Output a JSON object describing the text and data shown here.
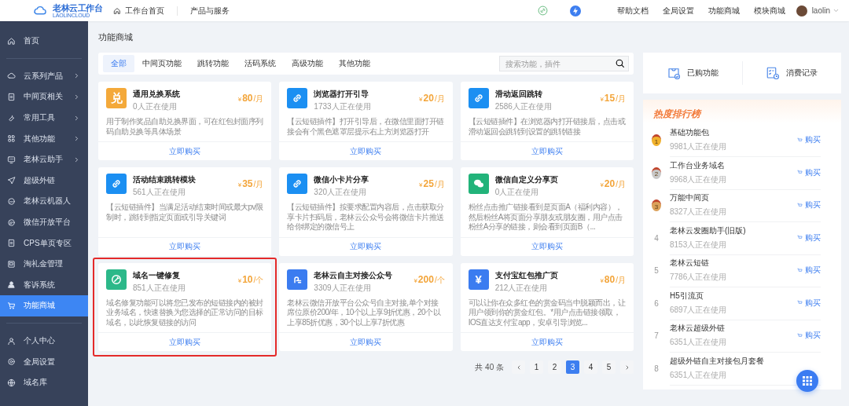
{
  "topbar": {
    "logo": {
      "title": "老林云工作台",
      "subtitle": "LAOLINCLOUD"
    },
    "nav": [
      "工作台首页",
      "产品与服务"
    ],
    "links": [
      "帮助文档",
      "全局设置",
      "功能商城",
      "模块商城"
    ],
    "user": "laolin"
  },
  "sidebar": {
    "sections": [
      {
        "items": [
          {
            "label": "首页",
            "expandable": false,
            "selected": false
          }
        ]
      },
      {
        "items": [
          {
            "label": "云系列产品",
            "expandable": true,
            "selected": false
          },
          {
            "label": "中间页相关",
            "expandable": true,
            "selected": false
          },
          {
            "label": "常用工具",
            "expandable": true,
            "selected": false
          },
          {
            "label": "其他功能",
            "expandable": true,
            "selected": false
          },
          {
            "label": "老林云助手",
            "expandable": true,
            "selected": false
          },
          {
            "label": "超级外链",
            "expandable": false,
            "selected": false
          },
          {
            "label": "老林云机器人",
            "expandable": false,
            "selected": false
          },
          {
            "label": "微信开放平台",
            "expandable": false,
            "selected": false
          },
          {
            "label": "CPS单页专区",
            "expandable": false,
            "selected": false
          },
          {
            "label": "淘礼金管理",
            "expandable": false,
            "selected": false
          },
          {
            "label": "客诉系统",
            "expandable": false,
            "selected": false
          },
          {
            "label": "功能商城",
            "expandable": false,
            "selected": true
          }
        ]
      },
      {
        "items": [
          {
            "label": "个人中心",
            "expandable": false,
            "selected": false
          },
          {
            "label": "全局设置",
            "expandable": false,
            "selected": false
          },
          {
            "label": "域名库",
            "expandable": false,
            "selected": false
          }
        ]
      }
    ]
  },
  "page_title": "功能商城",
  "tabs": [
    {
      "label": "全部",
      "selected": true
    },
    {
      "label": "中间页功能",
      "selected": false
    },
    {
      "label": "跳转功能",
      "selected": false
    },
    {
      "label": "活码系统",
      "selected": false
    },
    {
      "label": "高级功能",
      "selected": false
    },
    {
      "label": "其他功能",
      "selected": false
    }
  ],
  "search": {
    "placeholder": "搜索功能，插件"
  },
  "cards": [
    {
      "name": "通用兑换系统",
      "users": "0人正在使用",
      "currency": "¥",
      "price": "80",
      "unit": " /月",
      "description": "用于制作奖品自助兑换界面，可在红包封面序列码自助兑换等具体场景",
      "action": "立即购买",
      "kind": "glyph",
      "icon_text": "兑",
      "color": "#f4a93a",
      "highlighted": false
    },
    {
      "name": "浏览器打开引导",
      "users": "1733人正在使用",
      "currency": "¥",
      "price": "20",
      "unit": " /月",
      "description": "【云短链插件】打开引导后，在微信里面打开链接会有个黑色遮罩层提示右上方浏览器打开",
      "action": "立即购买",
      "kind": "link",
      "color": "#1b8ff2",
      "highlighted": false
    },
    {
      "name": "滑动返回跳转",
      "users": "2586人正在使用",
      "currency": "¥",
      "price": "15",
      "unit": " /月",
      "description": "【云短链插件】在浏览器内打开链接后，点击或滑动返回会跳转到设置的跳转链接",
      "action": "立即购买",
      "kind": "link",
      "color": "#1b8ff2",
      "highlighted": false
    },
    {
      "name": "活动结束跳转模块",
      "users": "561人正在使用",
      "currency": "¥",
      "price": "35",
      "unit": " /月",
      "description": "【云短链插件】当满足活动结束时间或最大pv限制时，跳转到指定页面或引导关键词",
      "action": "立即购买",
      "kind": "link",
      "color": "#1b8ff2",
      "highlighted": false
    },
    {
      "name": "微信小卡片分享",
      "users": "320人正在使用",
      "currency": "¥",
      "price": "25",
      "unit": " /月",
      "description": "【云短链插件】按要求配置内容后，点击获取分享卡片扫码后，老林云公众号会将微信卡片推送给你绑定的微信号上",
      "action": "立即购买",
      "kind": "link",
      "color": "#1b8ff2",
      "highlighted": false
    },
    {
      "name": "微信自定义分享页",
      "users": "0人正在使用",
      "currency": "¥",
      "price": "20",
      "unit": " /月",
      "description": "粉丝点击推广链接看到是页面A（福利内容），然后粉丝A将页面分享朋友或朋友圈，用户点击粉丝A分享的链接，则会看到页面B（...",
      "action": "立即购买",
      "kind": "chat",
      "color": "#22b37a",
      "highlighted": false
    },
    {
      "name": "域名一键修复",
      "users": "851人正在使用",
      "currency": "¥",
      "price": "10",
      "unit": "/个",
      "description": "域名修复功能可以将您已发布的短链接内的被封业务域名，快速替换为您选择的正常访问的目标域名，以此恢复链接的访问",
      "action": "立即购买",
      "kind": "wrench",
      "color": "#2cb889",
      "highlighted": true
    },
    {
      "name": "老林云自主对接公众号",
      "users": "3309人正在使用",
      "currency": "¥",
      "price": "200",
      "unit": "/个",
      "description": "老林云微信开放平台公众号自主对接,单个对接席位原价200/年，10个以上享9折优惠，20个以上享85折优惠，30个以上享7折优惠",
      "action": "立即购买",
      "kind": "account",
      "color": "#3b7cf0",
      "highlighted": false
    },
    {
      "name": "支付宝红包推广页",
      "users": "212人正在使用",
      "currency": "¥",
      "price": "80",
      "unit": " /月",
      "description": "可以让你在众多红色的赏金码当中脱颖而出，让用户领到你的赏金红包。*用户点击链接领取，IOS直达支付宝app，安卓引导浏览...",
      "action": "立即购买",
      "kind": "glyph",
      "icon_text": "¥",
      "color": "#3b7cf0",
      "highlighted": false
    }
  ],
  "pagination": {
    "total": "共 40 条",
    "pages": [
      {
        "label": "1",
        "selected": false
      },
      {
        "label": "2",
        "selected": false
      },
      {
        "label": "3",
        "selected": true
      },
      {
        "label": "4",
        "selected": false
      },
      {
        "label": "5",
        "selected": false
      }
    ]
  },
  "quick_links": [
    "已购功能",
    "消费记录"
  ],
  "ranking": {
    "title": "热度排行榜",
    "items": [
      {
        "rank": "1",
        "kind": "medal",
        "color": "#f0b22e",
        "name": "基础功能包",
        "users": "9981人正在使用",
        "action": "购买"
      },
      {
        "rank": "2",
        "kind": "medal",
        "color": "#c9c9c9",
        "name": "工作台业务域名",
        "users": "9968人正在使用",
        "action": "购买"
      },
      {
        "rank": "3",
        "kind": "medal",
        "color": "#dba15a",
        "name": "万能中间页",
        "users": "8327人正在使用",
        "action": "购买"
      },
      {
        "rank": "4",
        "kind": "number",
        "name": "老林云发圈助手(旧版)",
        "users": "8153人正在使用",
        "action": "购买"
      },
      {
        "rank": "5",
        "kind": "number",
        "name": "老林云短链",
        "users": "7786人正在使用",
        "action": "购买"
      },
      {
        "rank": "6",
        "kind": "number",
        "name": "H5引流页",
        "users": "6897人正在使用",
        "action": "购买"
      },
      {
        "rank": "7",
        "kind": "number",
        "name": "老林云超级外链",
        "users": "6351人正在使用",
        "action": "购买"
      },
      {
        "rank": "8",
        "kind": "number",
        "name": "超级外链自主对接包月套餐",
        "users": "6351人正在使用"
      }
    ]
  }
}
